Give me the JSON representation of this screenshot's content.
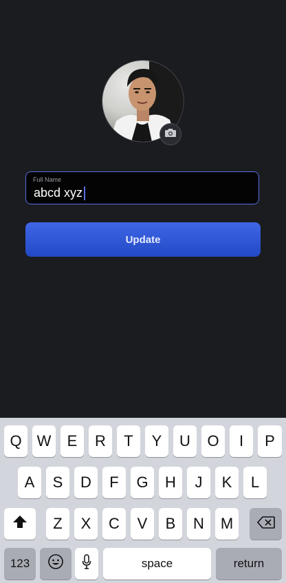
{
  "profile": {
    "camera_icon": "camera-icon"
  },
  "form": {
    "full_name_label": "Full Name",
    "full_name_value": "abcd xyz",
    "update_label": "Update"
  },
  "keyboard": {
    "row1": [
      "Q",
      "W",
      "E",
      "R",
      "T",
      "Y",
      "U",
      "O",
      "I",
      "P"
    ],
    "row2": [
      "A",
      "S",
      "D",
      "F",
      "G",
      "H",
      "J",
      "K",
      "L"
    ],
    "row3": [
      "Z",
      "X",
      "C",
      "V",
      "B",
      "N",
      "M"
    ],
    "numbers_label": "123",
    "space_label": "space",
    "return_label": "return",
    "shift_icon": "shift-icon",
    "backspace_icon": "backspace-icon",
    "emoji_icon": "emoji-icon",
    "mic_icon": "microphone-icon"
  },
  "colors": {
    "background": "#1b1c20",
    "accent": "#3f67e6",
    "field_border": "#5b6fe0"
  }
}
